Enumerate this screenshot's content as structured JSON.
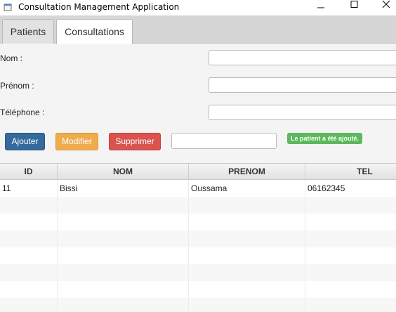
{
  "window": {
    "title": "Consultation Management Application",
    "icon": "java-app-icon",
    "controls": [
      "minimize-icon",
      "maximize-icon",
      "close-icon"
    ]
  },
  "tabs": [
    {
      "label": "Patients",
      "active": false
    },
    {
      "label": "Consultations",
      "active": true
    }
  ],
  "form": {
    "nom_label": "Nom :",
    "prenom_label": "Prénom :",
    "telephone_label": "Téléphone :",
    "nom_value": "",
    "prenom_value": "",
    "telephone_value": ""
  },
  "actions": {
    "add_label": "Ajouter",
    "edit_label": "Modifier",
    "delete_label": "Supprimer",
    "search_value": ""
  },
  "status": {
    "message": "Le patient a été ajouté.",
    "color": "#5cb85c"
  },
  "colors": {
    "add": "#356a9d",
    "edit": "#efac4e",
    "delete": "#d9534f"
  },
  "table": {
    "columns": [
      "ID",
      "NOM",
      "PRENOM",
      "TEL"
    ],
    "rows": [
      [
        "11",
        "Bissi",
        "Oussama",
        "06162345"
      ]
    ]
  }
}
